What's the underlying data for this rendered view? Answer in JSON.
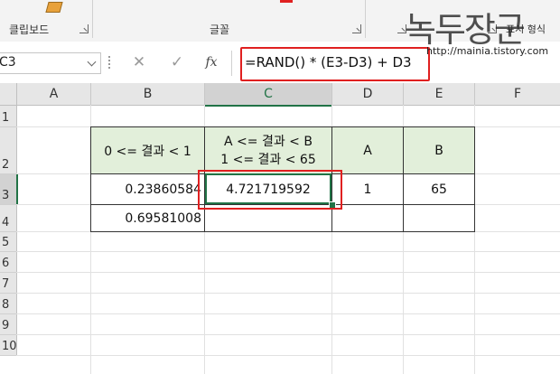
{
  "ribbon": {
    "clipboard_label": "클립보드",
    "font_label": "글꼴",
    "partial_label_right": "표시 형식",
    "brand_color": "#217346"
  },
  "name_box": {
    "value": "C3"
  },
  "formula_bar": {
    "cancel_icon": "✕",
    "enter_icon": "✓",
    "fx_label": "fx",
    "value": "=RAND() * (E3-D3) + D3"
  },
  "columns": [
    "A",
    "B",
    "C",
    "D",
    "E",
    "F"
  ],
  "rows": [
    "1",
    "2",
    "3",
    "4",
    "5",
    "6",
    "7",
    "8",
    "9",
    "10"
  ],
  "table": {
    "header_b": "0 <= 결과 < 1",
    "header_c_line1": "A <= 결과 < B",
    "header_c_line2": "1 <= 결과 < 65",
    "header_d": "A",
    "header_e": "B",
    "b3": "0.23860584",
    "c3": "4.721719592",
    "d3": "1",
    "e3": "65",
    "b4": "0.69581008"
  },
  "watermark": {
    "title": "녹두장군",
    "url": "http://mainia.tistory.com"
  },
  "colors": {
    "header_fill": "#e2efda",
    "highlight_red": "#e02020",
    "selection_green": "#217346"
  }
}
